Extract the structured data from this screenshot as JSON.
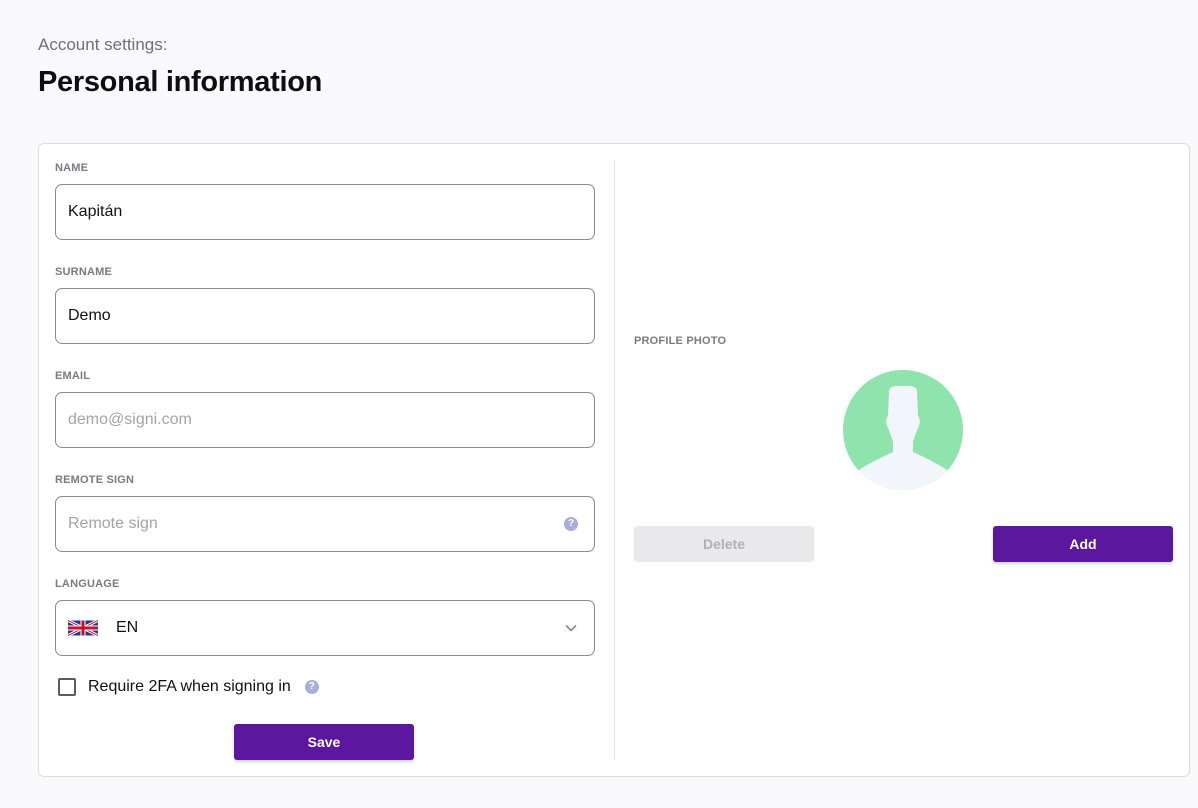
{
  "header": {
    "breadcrumb": "Account settings:",
    "title": "Personal information"
  },
  "form": {
    "name": {
      "label": "NAME",
      "value": "Kapitán"
    },
    "surname": {
      "label": "SURNAME",
      "value": "Demo"
    },
    "email": {
      "label": "EMAIL",
      "value": "demo@signi.com",
      "disabled": true
    },
    "remote_sign": {
      "label": "REMOTE SIGN",
      "placeholder": "Remote sign",
      "help_icon": "question-circle-icon"
    },
    "language": {
      "label": "LANGUAGE",
      "value": "EN",
      "flag_icon": "uk-flag-icon",
      "dropdown_icon": "chevron-down-icon"
    },
    "two_factor": {
      "label": "Require 2FA when signing in",
      "checked": false,
      "help_icon": "question-circle-icon"
    },
    "save_label": "Save"
  },
  "profile_photo": {
    "label": "PROFILE PHOTO",
    "avatar_icon": "default-user-avatar-icon",
    "delete_label": "Delete",
    "add_label": "Add"
  },
  "colors": {
    "primary": "#5b189f",
    "avatar_bg": "#8fe3ac",
    "avatar_figure": "#f2f5fc",
    "help_icon": "#a7aed9"
  }
}
